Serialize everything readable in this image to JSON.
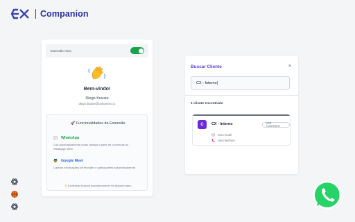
{
  "brand": {
    "logo_text": "CX",
    "name": "Companion"
  },
  "popup": {
    "toggle_label": "Extensão Ativa",
    "toggle_on": true,
    "welcome": "Bem-vindo!",
    "user_name": "Diego Krause",
    "user_email": "diego.krause@customerx.cx",
    "features_title": "🚀 Funcionalidades da Extensão",
    "features": [
      {
        "name": "WhatsApp",
        "icon": "chat-bubble-icon",
        "description": "Cria automaticamente notas rápidas a partir de conversas do WhatsApp Web"
      },
      {
        "name": "Google Meet",
        "icon": "spy-face-icon",
        "description": "Captura informações de reuniões e participantes automaticamente"
      }
    ],
    "note": "⚡ A extensão funciona automaticamente em segundo plano"
  },
  "search_panel": {
    "title": "Buscar Cliente",
    "close_label": "×",
    "search_value": "CX - Interno|",
    "result_count": "1 cliente encontrado",
    "client": {
      "initial": "C",
      "name": "CX - Interno",
      "button_label": "VER CONTRATO",
      "email": "Sem email",
      "phone": "Sem telefone"
    }
  },
  "side_icons": [
    "openai-knot-icon",
    "basketball-icon",
    "openai-knot-icon"
  ],
  "colors": {
    "brand": "#2e2f9e",
    "accent": "#5b3fd4",
    "toggle_on": "#16a34a",
    "whatsapp": "#25d366",
    "avatar": "#6d28d9"
  }
}
